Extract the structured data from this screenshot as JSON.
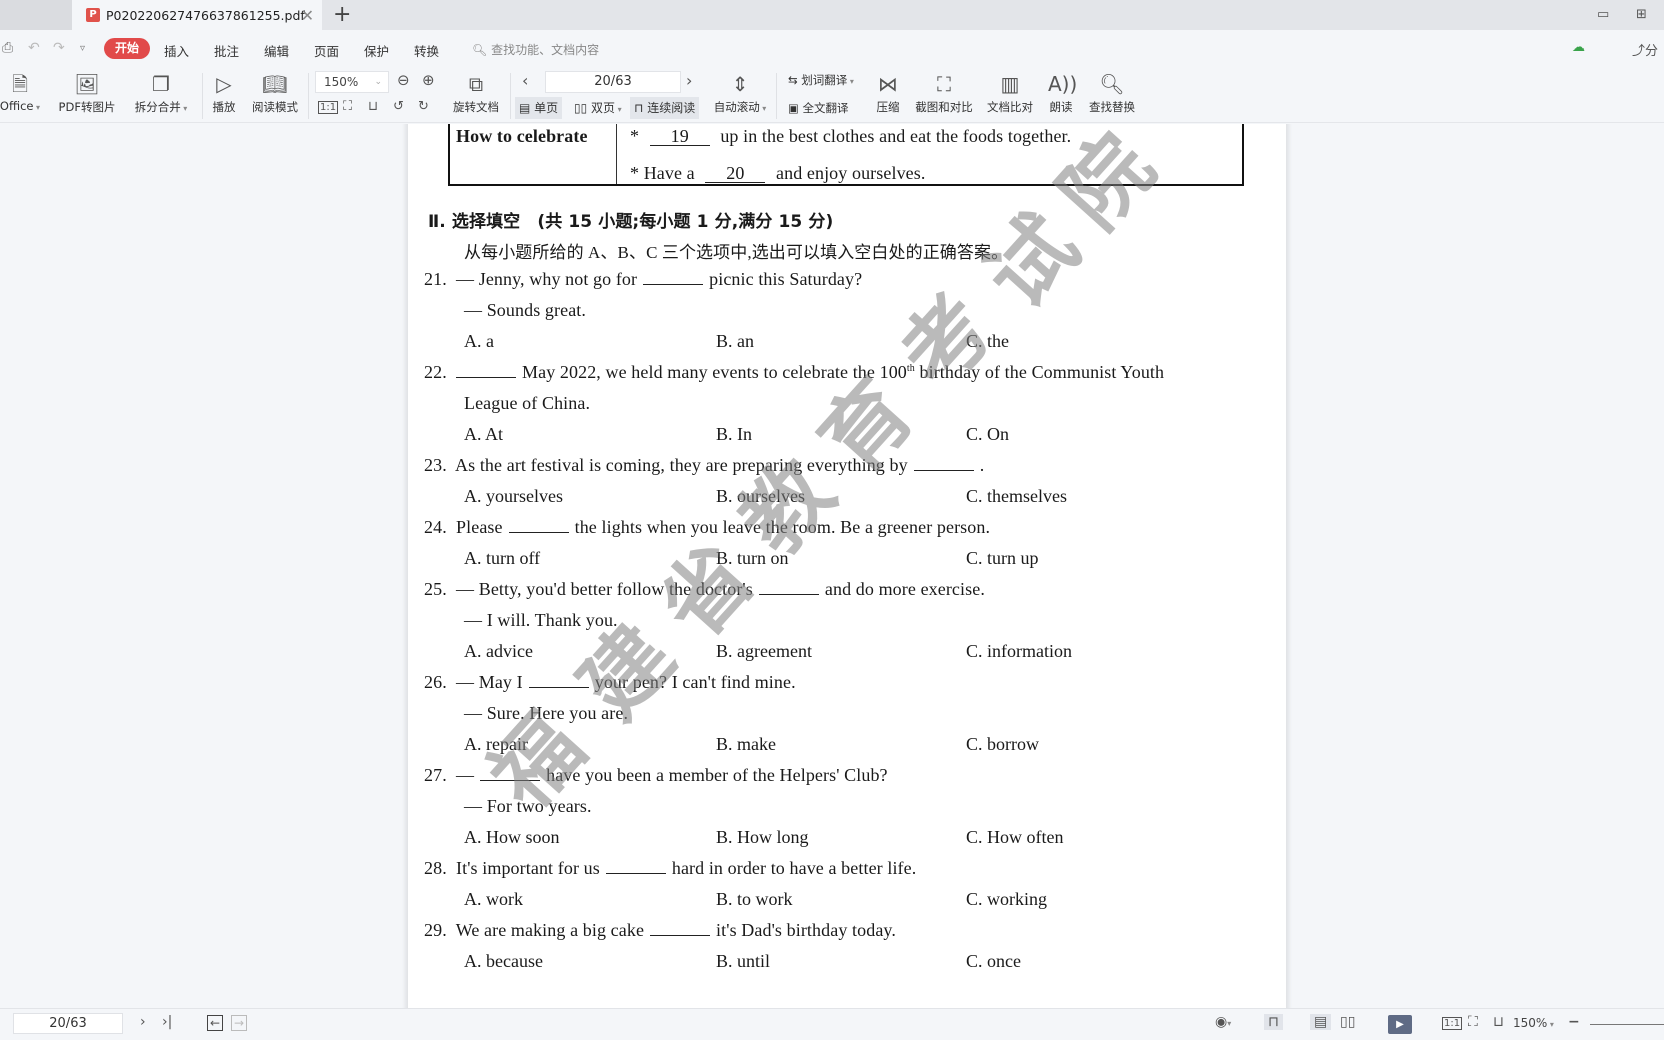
{
  "tabs": {
    "active_title": "P020220627476637861255.pdf",
    "add_label": "+"
  },
  "menu": {
    "items": [
      "开始",
      "插入",
      "批注",
      "编辑",
      "页面",
      "保护",
      "转换"
    ],
    "search_placeholder": "查找功能、文档内容",
    "share_label": "分"
  },
  "ribbon": {
    "office_label": "Office",
    "pdf_to_image": "PDF转图片",
    "split_merge": "拆分合并",
    "play": "播放",
    "read_mode": "阅读模式",
    "zoom_value": "150%",
    "rotate_doc": "旋转文档",
    "page_value": "20/63",
    "single_page": "单页",
    "double_page": "双页",
    "continuous": "连续阅读",
    "auto_scroll": "自动滚动",
    "word_translate": "划词翻译",
    "full_translate": "全文翻译",
    "compress": "压缩",
    "screenshot_compare": "截图和对比",
    "doc_compare": "文档比对",
    "read_aloud": "朗读",
    "find_replace": "查找替换"
  },
  "document": {
    "table": {
      "row_header": "How to celebrate",
      "line1_prefix": "*",
      "line1_blank": "19",
      "line1_text": "up in the best clothes and eat the foods together.",
      "line2_prefix": "*  Have a",
      "line2_blank": "20",
      "line2_text": "and enjoy ourselves."
    },
    "section_title": "Ⅱ. 选择填空　(共 15 小题;每小题 1 分,满分 15 分)",
    "section_instruction": "从每小题所给的 A、B、C 三个选项中,选出可以填入空白处的正确答案。",
    "questions": [
      {
        "num": "21.",
        "lines": [
          "— Jenny, why not go for",
          "picnic this Saturday?",
          "— Sounds great."
        ],
        "options": [
          "A.  a",
          "B.  an",
          "C.  the"
        ]
      },
      {
        "num": "22.",
        "lines": [
          "May 2022, we held many events to celebrate the 100",
          "th",
          "birthday of the Communist Youth",
          "League of China."
        ],
        "options": [
          "A.  At",
          "B.  In",
          "C.  On"
        ]
      },
      {
        "num": "23.",
        "lines": [
          "As the art festival is coming, they are preparing everything by",
          "."
        ],
        "options": [
          "A.  yourselves",
          "B.  ourselves",
          "C.  themselves"
        ]
      },
      {
        "num": "24.",
        "lines": [
          "Please",
          "the lights when you leave the room. Be a greener person."
        ],
        "options": [
          "A.  turn off",
          "B.  turn on",
          "C.  turn up"
        ]
      },
      {
        "num": "25.",
        "lines": [
          "— Betty, you'd better follow the doctor's",
          "and do more exercise.",
          "— I will.  Thank you."
        ],
        "options": [
          "A.  advice",
          "B.  agreement",
          "C.  information"
        ]
      },
      {
        "num": "26.",
        "lines": [
          "— May I",
          "your pen? I can't find mine.",
          "— Sure.  Here you are."
        ],
        "options": [
          "A.  repair",
          "B.  make",
          "C.  borrow"
        ]
      },
      {
        "num": "27.",
        "lines": [
          "—",
          "have you been a member of the Helpers' Club?",
          "— For two years."
        ],
        "options": [
          "A.  How soon",
          "B.  How long",
          "C.  How often"
        ]
      },
      {
        "num": "28.",
        "lines": [
          "It's important for us",
          "hard in order to have a better life."
        ],
        "options": [
          "A.  work",
          "B.  to work",
          "C.  working"
        ]
      },
      {
        "num": "29.",
        "lines": [
          "We are making a big cake",
          "it's Dad's birthday today."
        ],
        "options": [
          "A.  because",
          "B.  until",
          "C.  once"
        ]
      }
    ],
    "watermark_chars": [
      "福",
      "建",
      "省",
      "教",
      "育",
      "考",
      "试",
      "院"
    ]
  },
  "statusbar": {
    "page_value": "20/63",
    "zoom_value": "150%"
  }
}
